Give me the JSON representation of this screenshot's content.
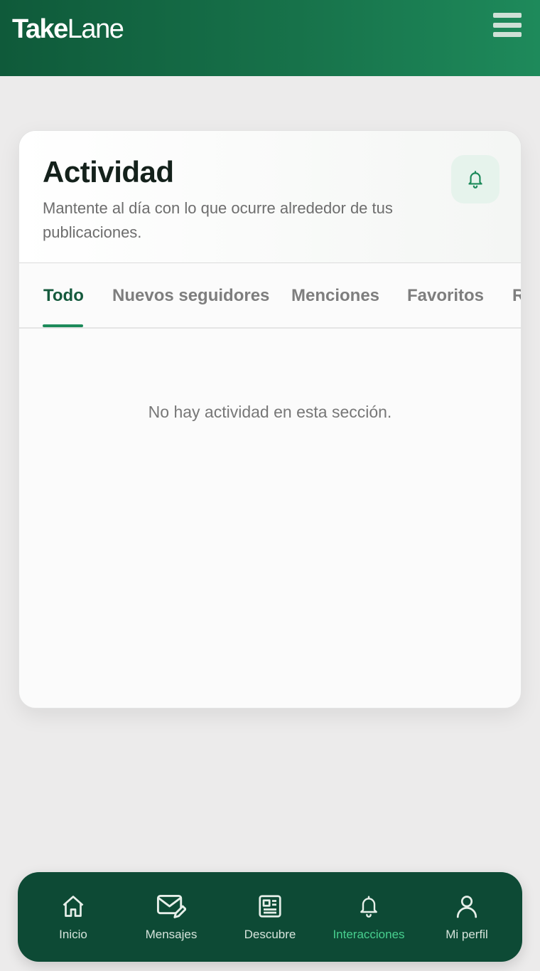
{
  "header": {
    "brand_bold": "Take",
    "brand_light": "Lane",
    "menu_icon": "hamburger-menu-icon"
  },
  "card": {
    "title": "Actividad",
    "subtitle": "Mantente al día con lo que ocurre alrededor de tus publicaciones.",
    "bell_icon": "bell-icon",
    "tabs": [
      {
        "label": "Todo",
        "active": true
      },
      {
        "label": "Nuevos seguidores",
        "active": false
      },
      {
        "label": "Menciones",
        "active": false
      },
      {
        "label": "Favoritos",
        "active": false
      },
      {
        "label": "R",
        "active": false
      }
    ],
    "empty_message": "No hay actividad en esta sección."
  },
  "bottom_nav": {
    "items": [
      {
        "label": "Inicio",
        "icon": "home-icon",
        "active": false
      },
      {
        "label": "Mensajes",
        "icon": "message-edit-icon",
        "active": false
      },
      {
        "label": "Descubre",
        "icon": "news-icon",
        "active": false
      },
      {
        "label": "Interacciones",
        "icon": "bell-icon",
        "active": true
      },
      {
        "label": "Mi perfil",
        "icon": "user-icon",
        "active": false
      }
    ]
  },
  "colors": {
    "brand_green": "#0d4a35",
    "accent_green": "#1c8a5a",
    "active_nav": "#48d08f"
  }
}
